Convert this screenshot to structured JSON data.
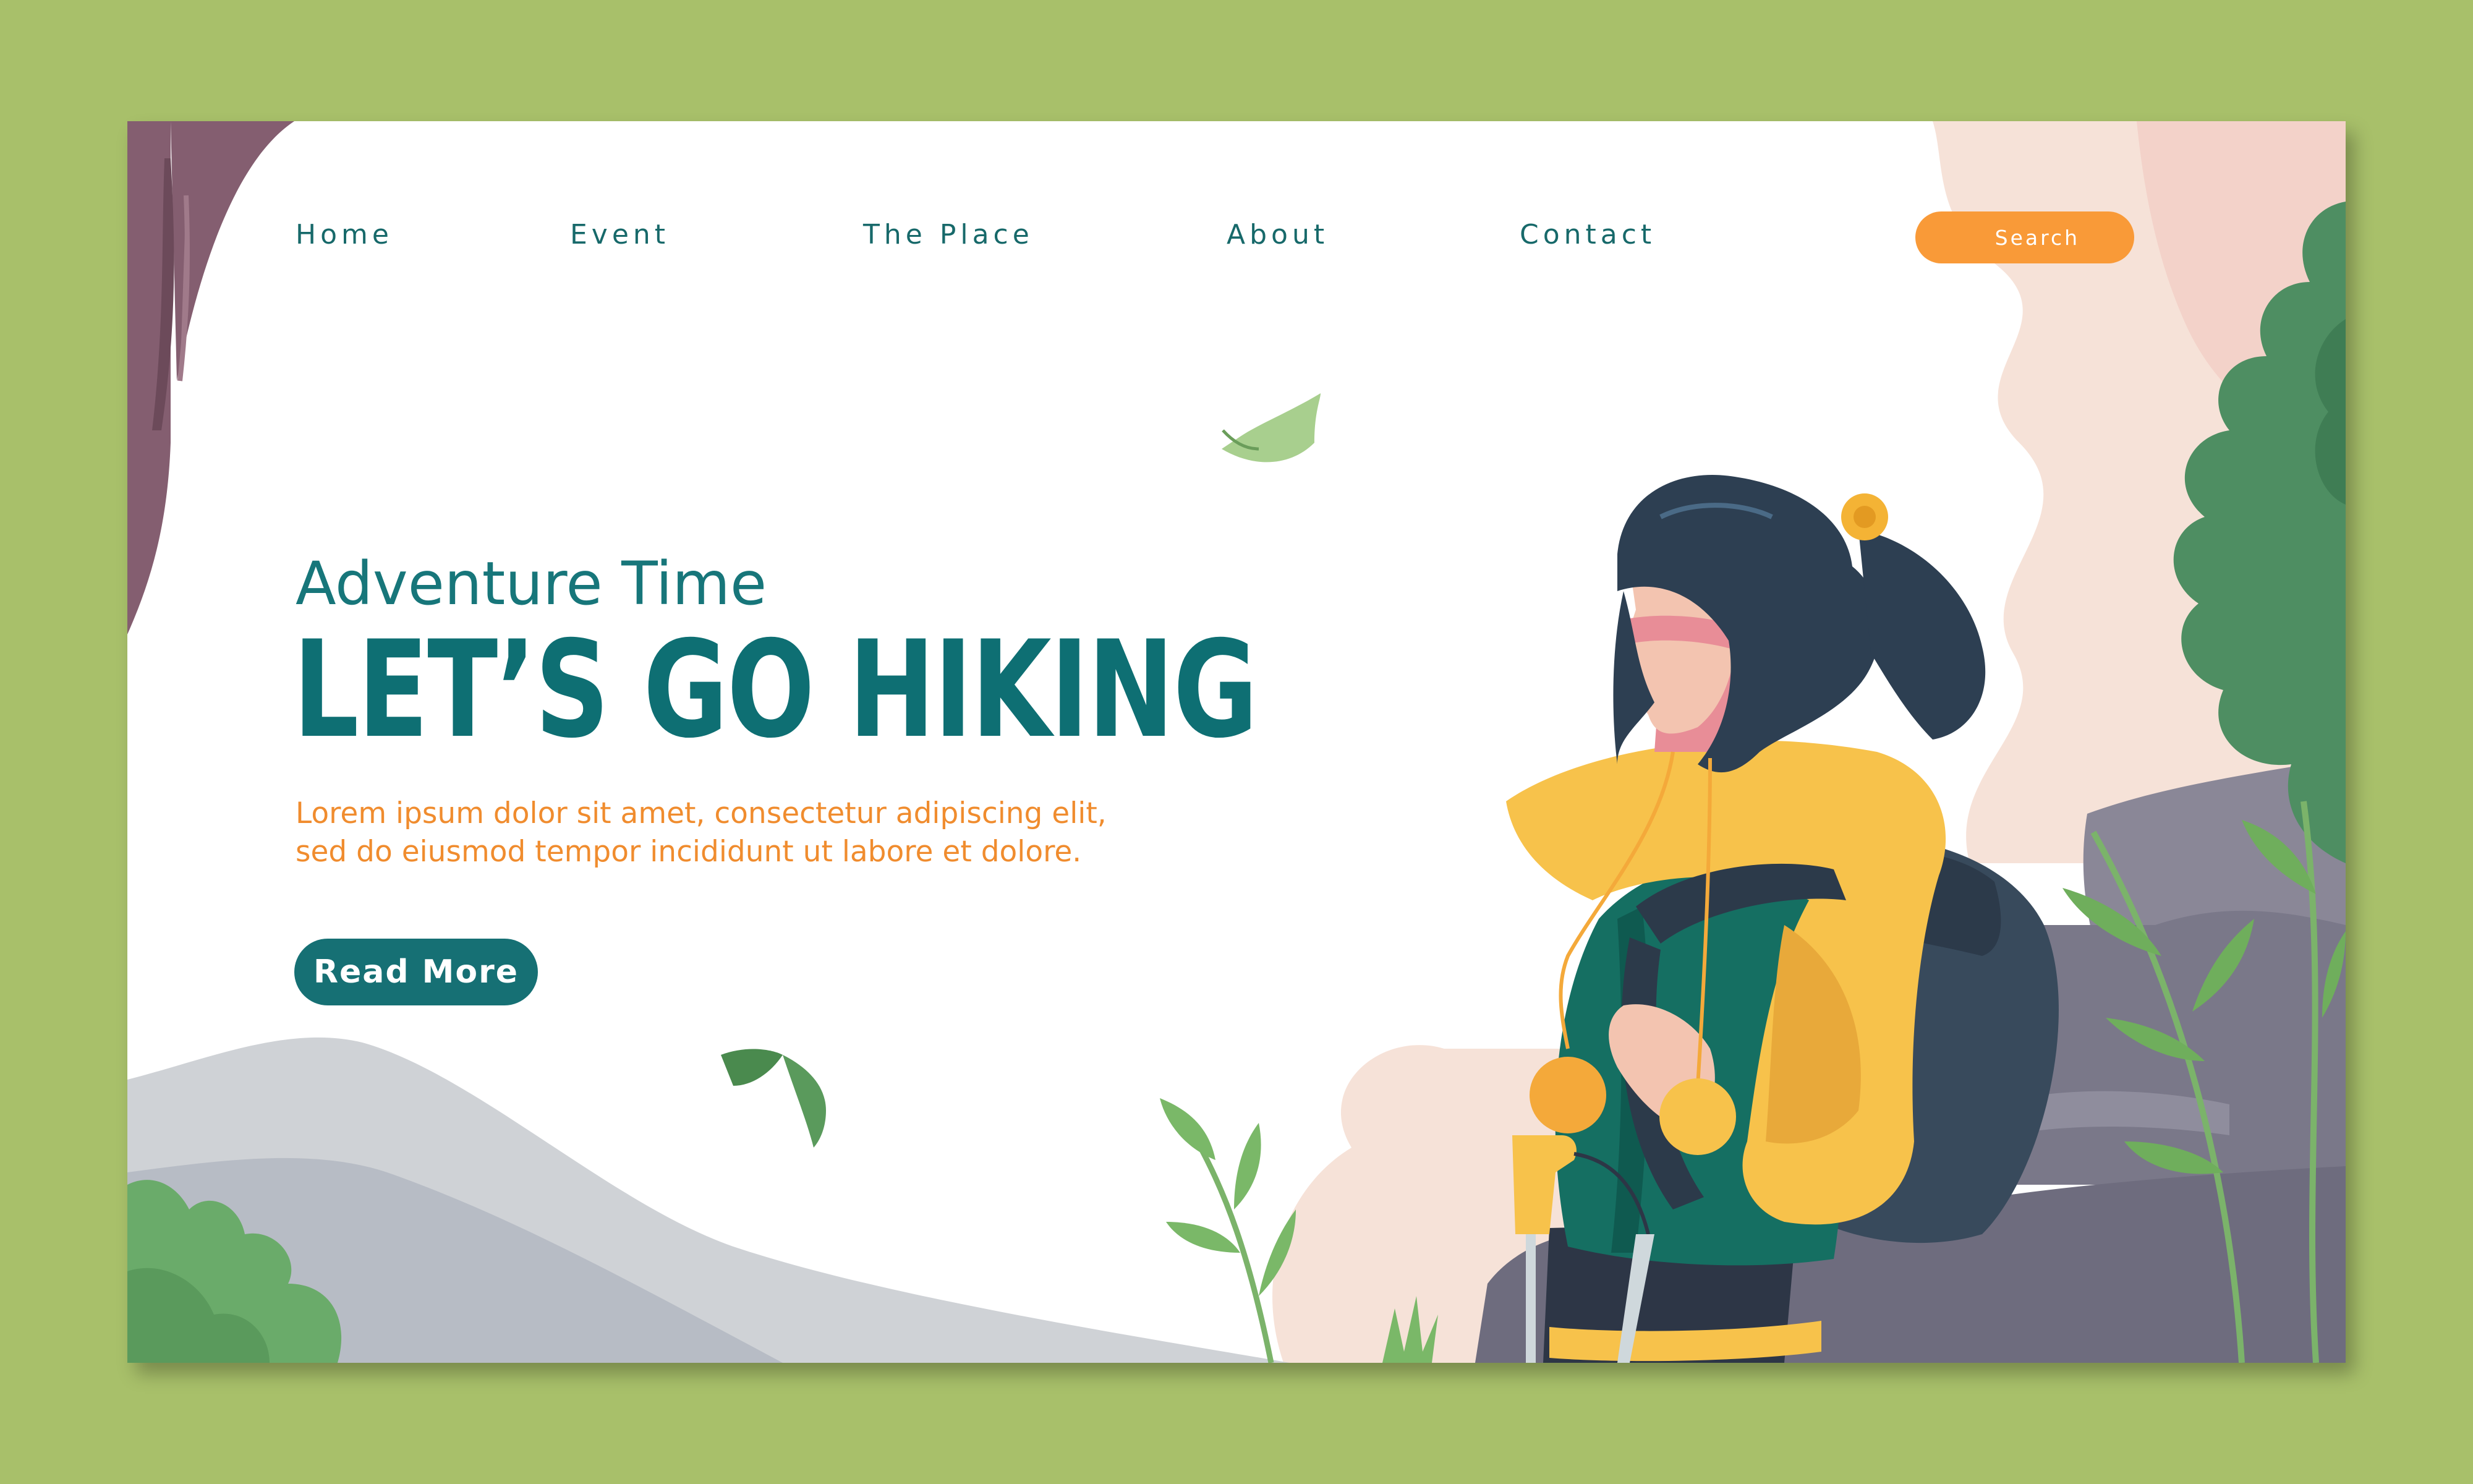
{
  "nav": {
    "items": [
      "Home",
      "Event",
      "The Place",
      "About",
      "Contact"
    ],
    "search_label": "Search"
  },
  "hero": {
    "subtitle": "Adventure Time",
    "title": "LET’S GO HIKING",
    "body_lines": [
      "Lorem ipsum dolor sit amet, consectetur adipiscing elit,",
      "sed do eiusmod tempor incididunt ut labore et dolore."
    ],
    "cta_label": "Read More"
  },
  "colors": {
    "page_background": "#a8c06a",
    "primary": "#0e6f73",
    "accent": "#f99a38",
    "body_text": "#f08c2e"
  },
  "icons": [
    "leaf-icon",
    "leaf-icon"
  ]
}
